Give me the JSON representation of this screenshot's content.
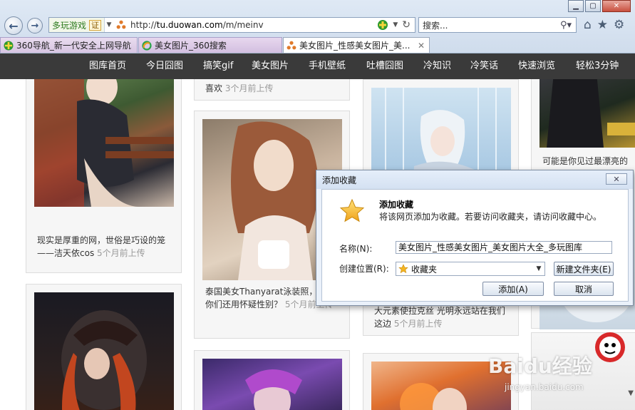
{
  "browser": {
    "address_prefix": "多玩游戏",
    "address_badge": "证",
    "url_host": "tu.duowan.com",
    "url_path": "/m/meinv",
    "url_scheme": "http://",
    "search_placeholder": "搜索..."
  },
  "tabs": [
    {
      "label": "360导航_新一代安全上网导航"
    },
    {
      "label": "美女图片_360搜索"
    },
    {
      "label": "美女图片_性感美女图片_美..."
    }
  ],
  "site_nav": [
    {
      "label": "图库首页"
    },
    {
      "label": "今日囧图"
    },
    {
      "label": "搞笑gif"
    },
    {
      "label": "美女图片"
    },
    {
      "label": "手机壁纸"
    },
    {
      "label": "吐槽囧图"
    },
    {
      "label": "冷知识"
    },
    {
      "label": "冷笑话"
    },
    {
      "label": "快速浏览"
    },
    {
      "label": "轻松3分钟"
    }
  ],
  "cards": [
    {
      "title": "现实是厚重的网，世俗是巧设的笼——洁天依cos",
      "time": "5个月前上传"
    },
    {
      "title_tail": "喜欢",
      "time": "3个月前上传"
    },
    {
      "title": "泰国美女Thanyarat泳装照，诩材你们还用怀疑性别？",
      "time": "5个月前上传"
    },
    {
      "title": "大元素使拉克丝 光明永远站在我们这边",
      "time": "5个月前上传"
    },
    {
      "title": "可能是你见过最漂亮的"
    }
  ],
  "dialog": {
    "window_title": "添加收藏",
    "headline": "添加收藏",
    "description": "将该网页添加为收藏。若要访问收藏夹，请访问收藏中心。",
    "name_label": "名称(N):",
    "name_value": "美女图片_性感美女图片_美女图片大全_多玩图库",
    "location_label": "创建位置(R):",
    "location_value": "收藏夹",
    "new_folder_button": "新建文件夹(E)",
    "add_button": "添加(A)",
    "cancel_button": "取消"
  },
  "watermark": {
    "brand": "Baidu经验",
    "url": "jingyan.baidu.com"
  }
}
